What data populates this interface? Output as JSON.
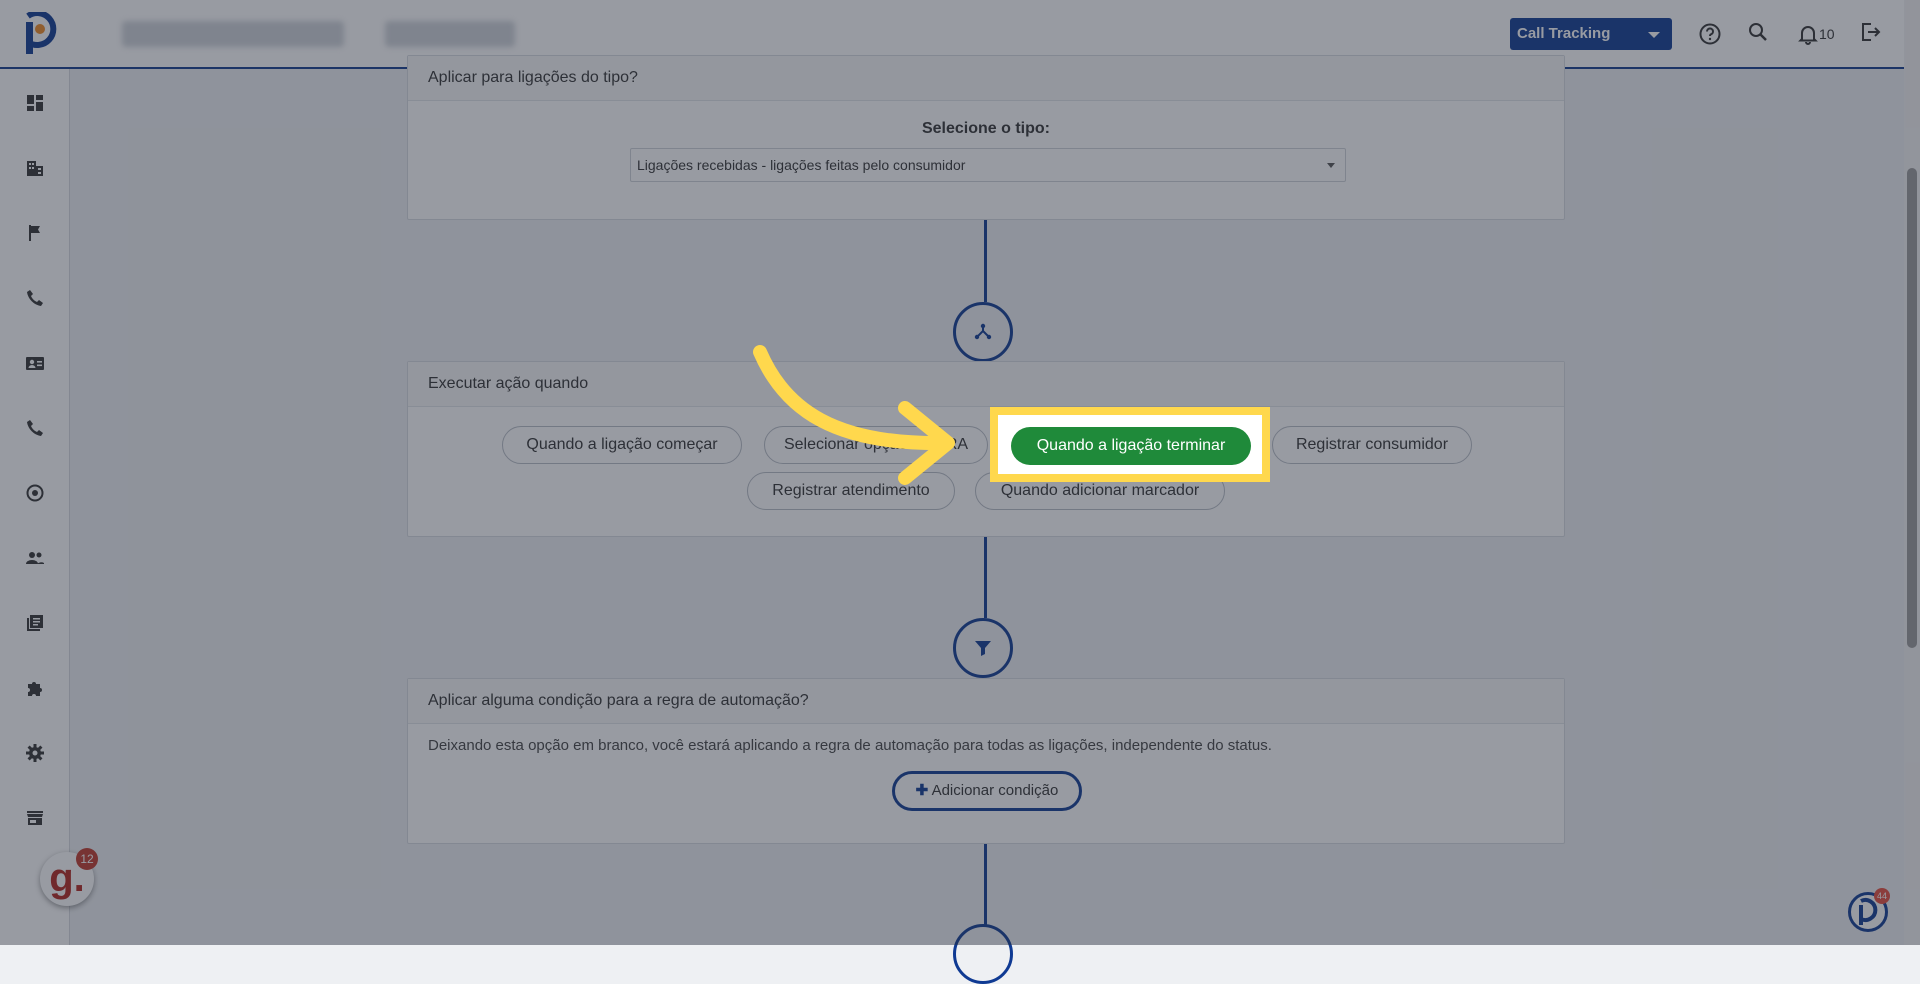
{
  "header": {
    "product_select": "Call Tracking",
    "notifications_count": "10",
    "icons": [
      "help-icon",
      "search-icon",
      "bell-icon",
      "logout-icon"
    ]
  },
  "sidebar": {
    "icons": [
      "dashboard-icon",
      "building-icon",
      "flag-icon",
      "phone-icon",
      "contact-card-icon",
      "phone-alt-icon",
      "record-icon",
      "people-icon",
      "library-icon",
      "puzzle-icon",
      "gear-icon",
      "store-icon"
    ]
  },
  "call_type_card": {
    "title": "Aplicar para ligações do tipo?",
    "select_label": "Selecione o tipo:",
    "select_value": "Ligações recebidas - ligações feitas pelo consumidor"
  },
  "trigger_card": {
    "title": "Executar ação quando",
    "options": [
      "Quando a ligação começar",
      "Selecionar opção da URA",
      "Quando a ligação terminar",
      "Registrar consumidor",
      "Registrar atendimento",
      "Quando adicionar marcador"
    ],
    "selected": "Quando a ligação terminar"
  },
  "condition_card": {
    "title": "Aplicar alguma condição para a regra de automação?",
    "description": "Deixando esta opção em branco, você estará aplicando a regra de automação para todas as ligações, independente do status.",
    "add_button": "Adicionar condição"
  },
  "widgets": {
    "g_badge_letter": "g.",
    "g_badge_count": "12",
    "p_badge_count": "44"
  },
  "colors": {
    "brand_blue": "#0f3a93",
    "selected_green": "#1f8a3a",
    "highlight_yellow": "#ffd84d"
  }
}
